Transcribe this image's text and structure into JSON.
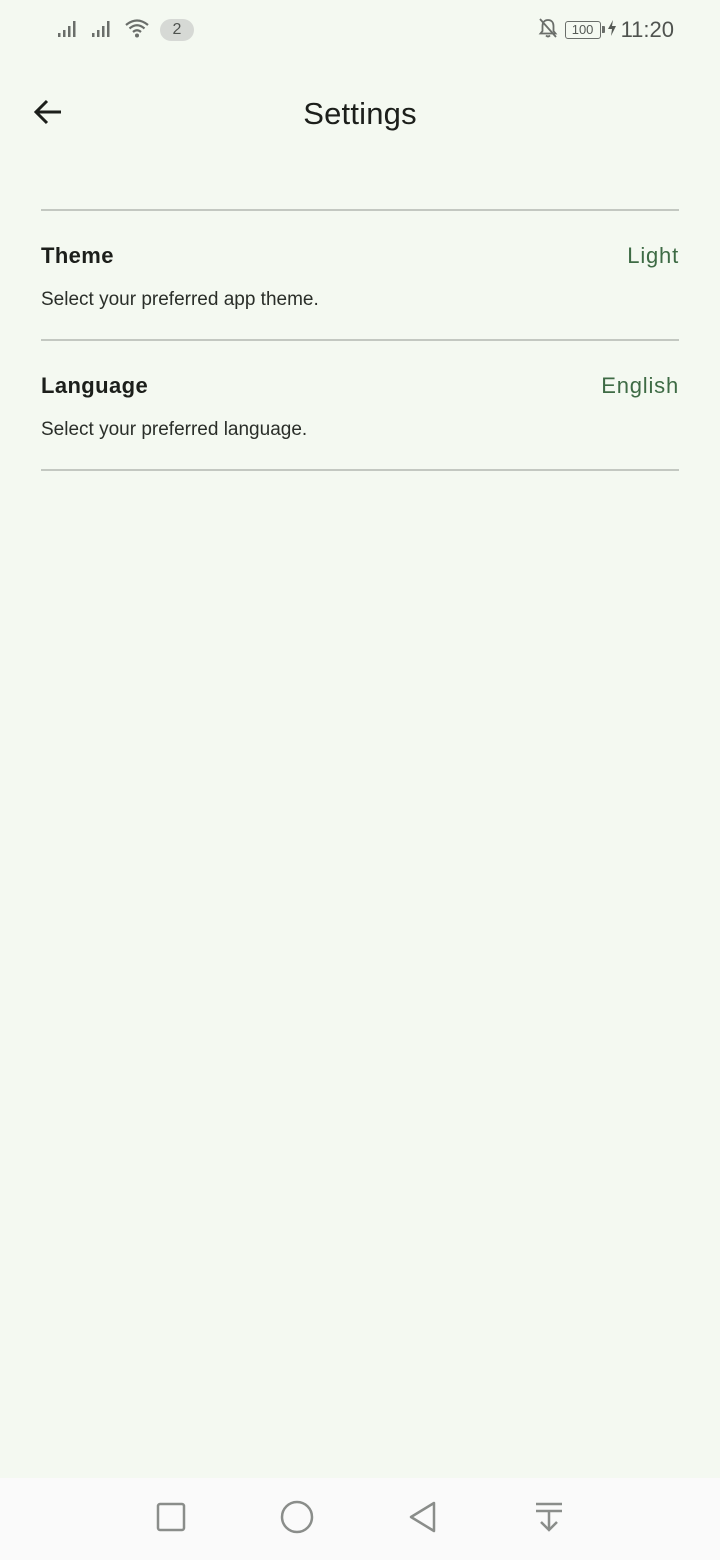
{
  "status_bar": {
    "notification_count": "2",
    "battery_level": "100",
    "time": "11:20",
    "icons": [
      "signal-icon",
      "signal-icon",
      "wifi-icon",
      "notifications-off-icon",
      "battery-icon",
      "charging-icon"
    ]
  },
  "app_bar": {
    "title": "Settings",
    "back_icon": "arrow-back-icon"
  },
  "settings": {
    "items": [
      {
        "title": "Theme",
        "value": "Light",
        "description": "Select your preferred app theme."
      },
      {
        "title": "Language",
        "value": "English",
        "description": "Select your preferred language."
      }
    ]
  },
  "nav_bar": {
    "icons": [
      "recents-icon",
      "home-icon",
      "back-icon",
      "notification-shade-icon"
    ]
  },
  "colors": {
    "background": "#f4f9f1",
    "accent_value": "#3e6b45",
    "divider": "#c3c8c1",
    "text_primary": "#1c1f1b"
  }
}
